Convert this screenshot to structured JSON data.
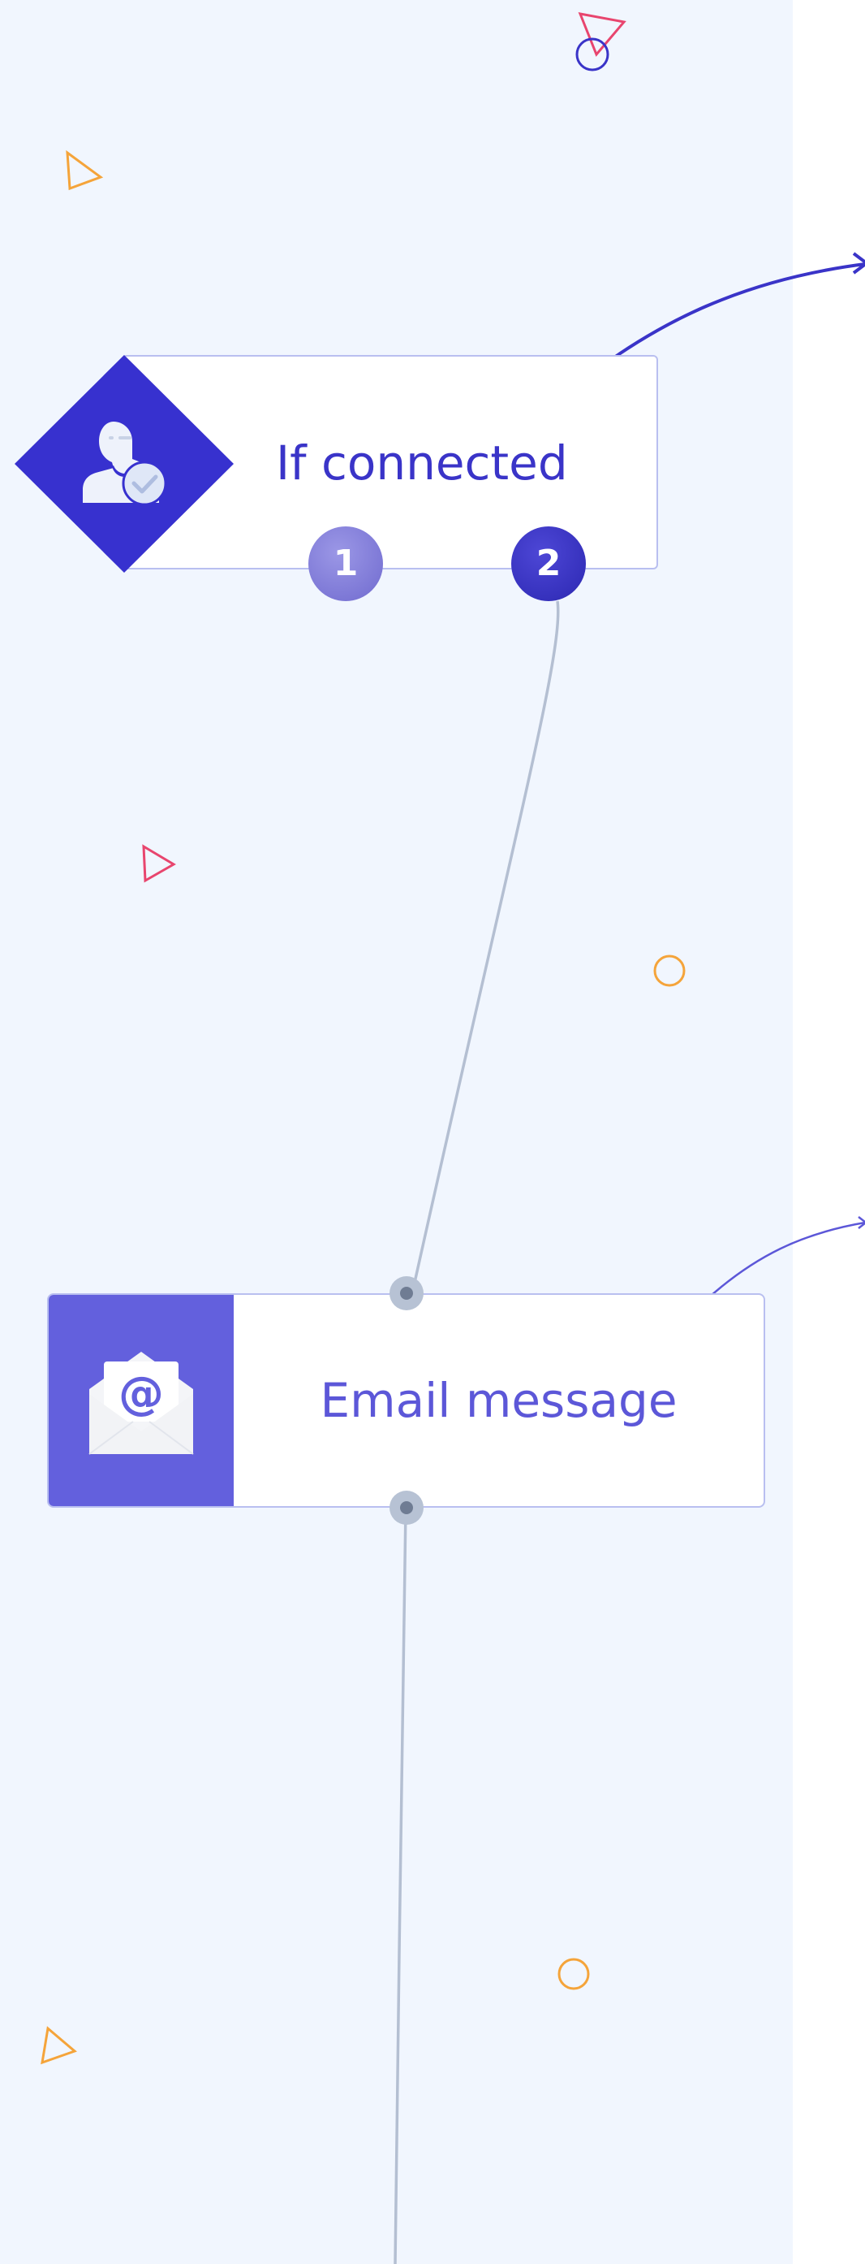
{
  "workflow": {
    "nodes": [
      {
        "id": "if-connected",
        "label": "If connected",
        "icon": "connected-user-icon",
        "branches": [
          "1",
          "2"
        ]
      },
      {
        "id": "email-message",
        "label": "Email message",
        "icon": "email-envelope-icon"
      }
    ]
  },
  "colors": {
    "canvas_background": "#f1f6fe",
    "condition_accent": "#3731cf",
    "email_accent": "#6360dd",
    "node_border": "#b9bff0",
    "connector": "#b4bfd2",
    "branch_1": "#7d78d6",
    "branch_2": "#3631bd",
    "deco_orange": "#f5a43a",
    "deco_pink": "#e8456e",
    "deco_blue": "#3a34c8"
  }
}
